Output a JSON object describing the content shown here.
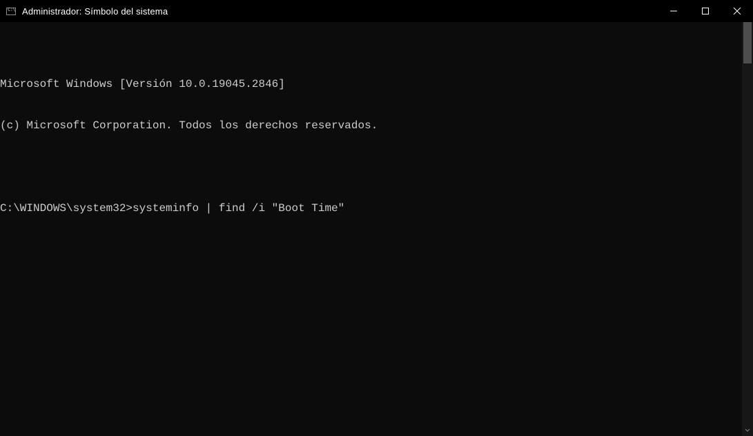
{
  "titlebar": {
    "title": "Administrador: Símbolo del sistema"
  },
  "terminal": {
    "line1": "Microsoft Windows [Versión 10.0.19045.2846]",
    "line2": "(c) Microsoft Corporation. Todos los derechos reservados.",
    "blank": "",
    "prompt": "C:\\WINDOWS\\system32>",
    "command": "systeminfo | find /i \"Boot Time\""
  }
}
